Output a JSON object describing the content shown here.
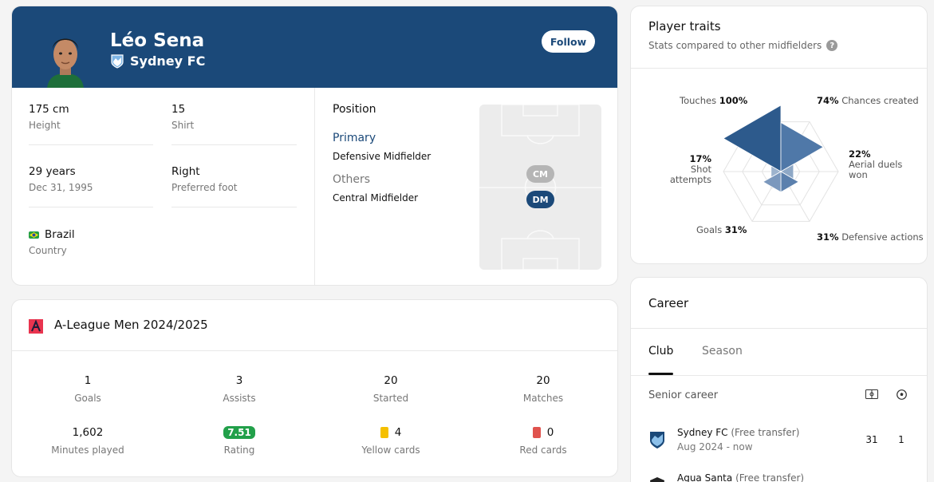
{
  "player": {
    "name": "Léo Sena",
    "club": "Sydney FC",
    "follow_label": "Follow"
  },
  "info": {
    "height": {
      "value": "175 cm",
      "label": "Height"
    },
    "shirt": {
      "value": "15",
      "label": "Shirt"
    },
    "age": {
      "value": "29 years",
      "label": "Dec 31, 1995"
    },
    "foot": {
      "value": "Right",
      "label": "Preferred foot"
    },
    "country": {
      "value": "Brazil",
      "label": "Country"
    }
  },
  "position": {
    "title": "Position",
    "primary_label": "Primary",
    "primary_value": "Defensive Midfielder",
    "others_label": "Others",
    "others_value": "Central Midfielder",
    "badges": [
      "CM",
      "DM"
    ]
  },
  "league": {
    "title": "A-League Men 2024/2025",
    "stats": [
      {
        "value": "1",
        "label": "Goals"
      },
      {
        "value": "3",
        "label": "Assists"
      },
      {
        "value": "20",
        "label": "Started"
      },
      {
        "value": "20",
        "label": "Matches"
      },
      {
        "value": "1,602",
        "label": "Minutes played"
      },
      {
        "value": "7.51",
        "label": "Rating"
      },
      {
        "value": "4",
        "label": "Yellow cards"
      },
      {
        "value": "0",
        "label": "Red cards"
      }
    ]
  },
  "traits": {
    "title": "Player traits",
    "subtitle": "Stats compared to other midfielders",
    "help_icon": "?",
    "items": [
      {
        "name": "Touches",
        "value": "100%"
      },
      {
        "name": "Chances created",
        "value": "74%"
      },
      {
        "name": "Aerial duels won",
        "value": "22%"
      },
      {
        "name": "Defensive actions",
        "value": "31%"
      },
      {
        "name": "Goals",
        "value": "31%"
      },
      {
        "name": "Shot attempts",
        "value": "17%"
      }
    ],
    "levels": [
      1.0,
      0.74,
      0.22,
      0.31,
      0.31,
      0.17
    ]
  },
  "career": {
    "title": "Career",
    "tabs": [
      "Club",
      "Season"
    ],
    "active_tab": "Club",
    "section_label": "Senior career",
    "rows": [
      {
        "club": "Sydney FC",
        "note": "(Free transfer)",
        "dates": "Aug 2024 - now",
        "apps": "31",
        "goals": "1"
      },
      {
        "club": "Agua Santa",
        "note": "(Free transfer)",
        "dates": "",
        "apps": "",
        "goals": ""
      }
    ]
  },
  "colors": {
    "primary": "#1b4979",
    "rating": "#22a04a",
    "yellow": "#f5c000",
    "red": "#e0534e"
  }
}
